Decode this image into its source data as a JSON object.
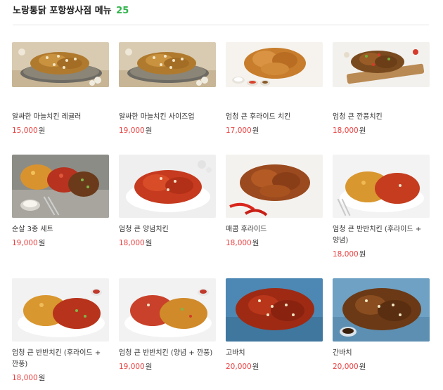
{
  "header": {
    "title": "노랑통닭 포항쌍사점 메뉴",
    "count": "25"
  },
  "colors": {
    "accent_count": "#2fb44a",
    "price": "#e94343"
  },
  "menu": [
    {
      "name": "알싸한 마늘치킨 레귤러",
      "price": "15,000",
      "unit": "원",
      "image_icon": "garlic-chicken-photo"
    },
    {
      "name": "알싸한 마늘치킨 사이즈업",
      "price": "19,000",
      "unit": "원",
      "image_icon": "garlic-chicken-photo"
    },
    {
      "name": "엄청 큰 후라이드 치킨",
      "price": "17,000",
      "unit": "원",
      "image_icon": "fried-chicken-photo"
    },
    {
      "name": "엄청 큰 깐풍치킨",
      "price": "18,000",
      "unit": "원",
      "image_icon": "kkanpung-chicken-photo"
    },
    {
      "name": "순살 3종 세트",
      "price": "19,000",
      "unit": "원",
      "image_icon": "boneless-set-photo"
    },
    {
      "name": "엄청 큰 양념치킨",
      "price": "18,000",
      "unit": "원",
      "image_icon": "seasoned-chicken-photo"
    },
    {
      "name": "매콤 후라이드",
      "price": "18,000",
      "unit": "원",
      "image_icon": "spicy-fried-photo"
    },
    {
      "name": "엄청 큰 반반치킨 (후라이드 + 양념)",
      "price": "18,000",
      "unit": "원",
      "image_icon": "half-half-photo"
    },
    {
      "name": "엄청 큰 반반치킨 (후라이드 + 깐풍)",
      "price": "18,000",
      "unit": "원",
      "image_icon": "half-half-photo"
    },
    {
      "name": "엄청 큰 반반치킨 (양념 + 깐풍)",
      "price": "19,000",
      "unit": "원",
      "image_icon": "half-half-photo"
    },
    {
      "name": "고바치",
      "price": "20,000",
      "unit": "원",
      "image_icon": "gobachi-photo"
    },
    {
      "name": "간바치",
      "price": "20,000",
      "unit": "원",
      "image_icon": "ganbachi-photo"
    }
  ]
}
